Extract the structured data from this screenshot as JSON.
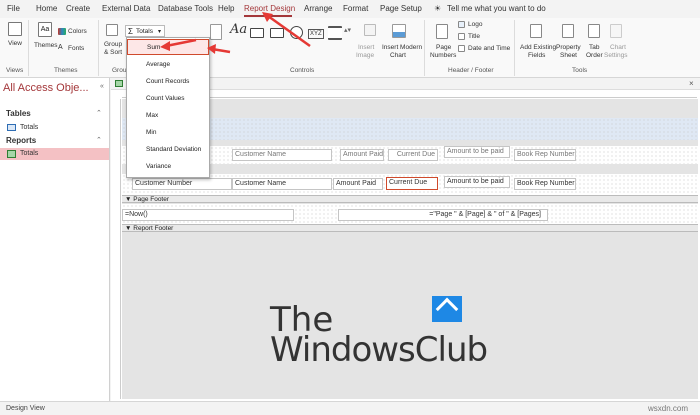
{
  "ribbon_tabs": [
    "File",
    "Home",
    "Create",
    "External Data",
    "Database Tools",
    "Help",
    "Report Design",
    "Arrange",
    "Format",
    "Page Setup"
  ],
  "active_tab": "Report Design",
  "tell_me": "Tell me what you want to do",
  "ribbon": {
    "views": {
      "button": "View",
      "group": "Views"
    },
    "themes": {
      "themes": "Themes",
      "colors": "Colors",
      "fonts": "Fonts",
      "group": "Themes"
    },
    "grouping": {
      "group_sort": "Group",
      "group_sort2": "& Sort",
      "totals": "Totals",
      "group": "Grou"
    },
    "controls": {
      "insert_image": "Insert",
      "insert_image2": "Image",
      "insert_chart": "Insert Modern",
      "insert_chart2": "Chart",
      "group": "Controls"
    },
    "header_footer": {
      "page_numbers": "Page",
      "page_numbers2": "Numbers",
      "logo": "Logo",
      "title": "Title",
      "date_time": "Date and Time",
      "group": "Header / Footer"
    },
    "tools": {
      "add_fields": "Add Existing",
      "add_fields2": "Fields",
      "property_sheet": "Property",
      "property_sheet2": "Sheet",
      "tab_order": "Tab",
      "tab_order2": "Order",
      "chart_settings": "Chart",
      "chart_settings2": "Settings",
      "group": "Tools"
    }
  },
  "totals_menu": [
    "Sum",
    "Average",
    "Count Records",
    "Count Values",
    "Max",
    "Min",
    "Standard Deviation",
    "Variance"
  ],
  "nav": {
    "title": "All Access Obje...",
    "tables_section": "Tables",
    "tables_items": [
      "Totals"
    ],
    "reports_section": "Reports",
    "reports_items": [
      "Totals"
    ]
  },
  "design": {
    "header_fields": [
      "Customer Name",
      "Amount Paid",
      "Current Due",
      "Amount to be paid",
      "Book Rep Number"
    ],
    "detail_fields": [
      "Customer Number",
      "Customer Name",
      "Amount Paid",
      "Current Due",
      "Amount to be paid",
      "Book Rep Number"
    ],
    "page_footer_label": "Page Footer",
    "report_footer_label": "Report Footer",
    "now_expr": "=Now()",
    "page_expr": "=\"Page \" & [Page] & \" of \" & [Pages]"
  },
  "status": "Design View",
  "watermark": {
    "line1": "The",
    "line2": "WindowsClub",
    "site": "wsxdn.com"
  },
  "colors": {
    "accent": "#a4373a",
    "highlight": "#d04a2c",
    "selected_nav": "#f4c1c4"
  }
}
